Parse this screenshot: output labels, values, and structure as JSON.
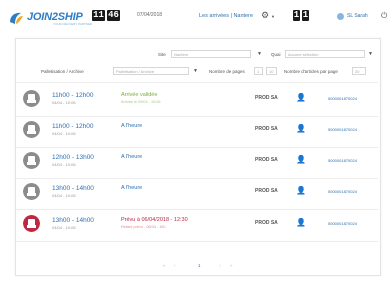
{
  "header": {
    "logo_text": "JOIN2SHIP",
    "logo_tagline": "YOUR DELIVERY PARTNER",
    "clock_h": "11",
    "clock_m": "46",
    "date": "07/04/2018",
    "title": "Les arrivées | Nantere",
    "clock2_h": "1",
    "clock2_m": "1",
    "user": "SL Sarah",
    "colors": {
      "brand": "#2e7dc4",
      "link": "#2e6fb0"
    }
  },
  "filters": {
    "site_label": "Site",
    "site_value": "Nantere",
    "quai_label": "Quai",
    "quai_value": "Aucune sélection",
    "pallet_label": "Palletisation / Archive",
    "pallet_value": "Palletisation / Archive",
    "perpage_label": "Nombre de pages",
    "perpage_value": "1",
    "perpage_value2": "10",
    "visible_label": "Nombre d'articles par page",
    "visible_value": "20"
  },
  "rows": [
    {
      "time": "11h00 - 12h00",
      "date": "04/04 - 10:06",
      "status": "Arrivée validée",
      "status_sub": "Arrivée le 05/04 - 10:06",
      "carrier": "PROD SA",
      "ref": "5000001870024",
      "icon_color": "#8c8c8c",
      "status_color": "#79b03a"
    },
    {
      "time": "11h00 - 12h00",
      "date": "04/04 - 10:06",
      "status": "A l'heure",
      "status_sub": "",
      "carrier": "PROD SA",
      "ref": "5000001870024",
      "icon_color": "#8c8c8c",
      "status_color": "#2e6fb0"
    },
    {
      "time": "12h00 - 13h00",
      "date": "04/04 - 10:06",
      "status": "A l'heure",
      "status_sub": "",
      "carrier": "PROD SA",
      "ref": "5000001870024",
      "icon_color": "#8c8c8c",
      "status_color": "#2e6fb0"
    },
    {
      "time": "13h00 - 14h00",
      "date": "04/04 - 10:06",
      "status": "A l'heure",
      "status_sub": "",
      "carrier": "PROD SA",
      "ref": "5000001870024",
      "icon_color": "#8c8c8c",
      "status_color": "#2e6fb0"
    },
    {
      "time": "13h00 - 14h00",
      "date": "04/04 - 10:06",
      "status": "Prévu à 06/04/2018 - 12:30",
      "status_sub": "Retard prévu - 06/04 - 10h",
      "carrier": "PROD SA",
      "ref": "5000001870024",
      "icon_color": "#c0283f",
      "status_color": "#c0283f"
    }
  ],
  "pager": {
    "prev": "«",
    "prev2": "‹",
    "current": "1",
    "next": "›",
    "next2": "»"
  },
  "icons": {
    "logo": "join2ship-logo-icon",
    "settings": "gear-icon",
    "user": "user-avatar-icon",
    "logout": "logout-icon",
    "truck": "truck-icon",
    "person": "person-icon"
  }
}
